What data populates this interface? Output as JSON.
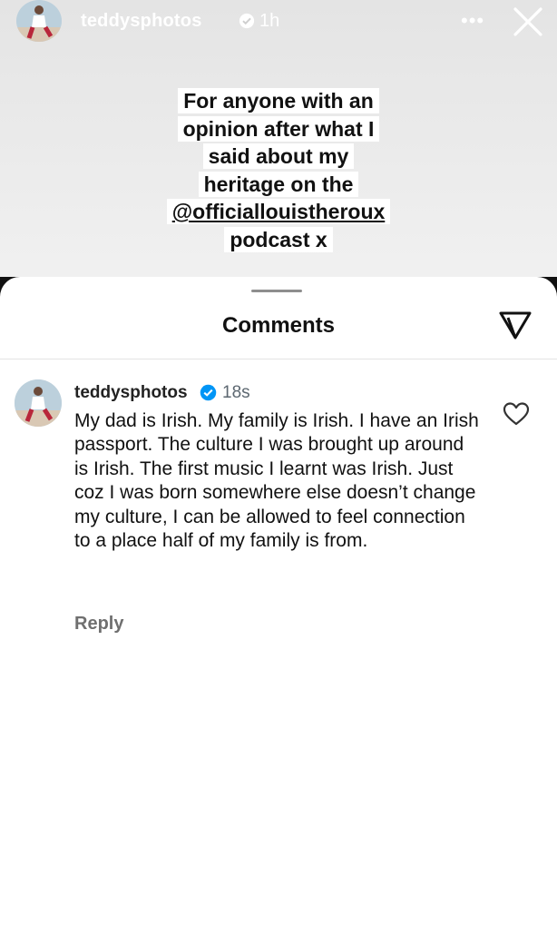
{
  "story": {
    "username": "teddysphotos",
    "time": "1h",
    "caption_lines": [
      "For anyone with an",
      "opinion after what I",
      "said about my",
      "heritage on the",
      "@officiallouistheroux",
      "podcast x"
    ]
  },
  "comments_sheet": {
    "title": "Comments"
  },
  "comment": {
    "username": "teddysphotos",
    "time": "18s",
    "text": "My dad is Irish. My family is Irish. I have an Irish passport. The culture I was brought up around is Irish. The first music I learnt was Irish. Just coz I was born somewhere else doesn’t change my culture, I can be allowed to feel connection to a place half of my family is from.",
    "reply_label": "Reply"
  },
  "icons": {
    "verified": "verified-badge-icon",
    "more": "more-options-icon",
    "close": "close-icon",
    "share": "send-icon",
    "like": "heart-icon"
  },
  "colors": {
    "verified_blue": "#0095f6",
    "story_bg": "#e8e8e8",
    "text": "#111111",
    "muted": "#6f6f6f"
  }
}
